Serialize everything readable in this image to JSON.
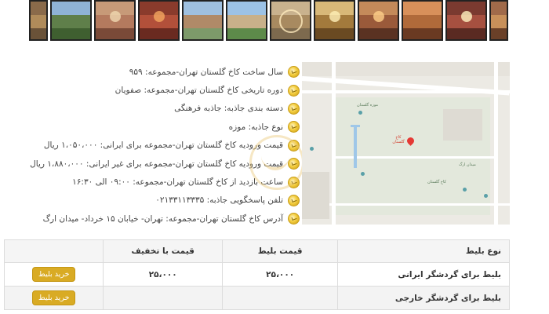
{
  "info_items": [
    "سال ساخت کاخ گلستان تهران-مجموعه: ۹۵۹",
    "دوره تاریخی کاخ گلستان تهران-مجموعه: صفویان",
    "دسته بندی جاذبه: جاذبه فرهنگی",
    "نوع جاذبه: موزه",
    "قیمت ورودیه کاخ گلستان تهران-مجموعه برای ایرانی: ۱،۰۵۰،۰۰۰ ریال",
    "قیمت ورودیه کاخ گلستان تهران-مجموعه برای غیر ایرانی: ۱،۸۸۰،۰۰۰ ریال",
    "ساعت بازدید از کاخ گلستان تهران-مجموعه: ۰۹:۰۰ الی ۱۶:۳۰",
    "تلفن پاسخگویی جاذبه: ۰۲۱۳۳۱۱۳۳۳۵",
    "آدرس کاخ گلستان تهران-مجموعه: تهران- خیابان ۱۵ خرداد- میدان ارگ"
  ],
  "table": {
    "headers": {
      "type": "نوع بلیط",
      "price": "قیمت بلیط",
      "discount": "قیمت با تخفیف"
    },
    "rows": [
      {
        "type": "بلیط برای گردشگر ایرانی",
        "price": "۲۵،۰۰۰",
        "discount": "۲۵،۰۰۰",
        "button": "خرید بلیط"
      },
      {
        "type": "بلیط برای گردشگر خارجی",
        "price": "",
        "discount": "",
        "button": "خرید بلیط"
      }
    ]
  },
  "map": {
    "pin_label": "کاخ گلستان"
  },
  "colors": {
    "accent_gold": "#d9ab24",
    "pin_red": "#e53935"
  }
}
